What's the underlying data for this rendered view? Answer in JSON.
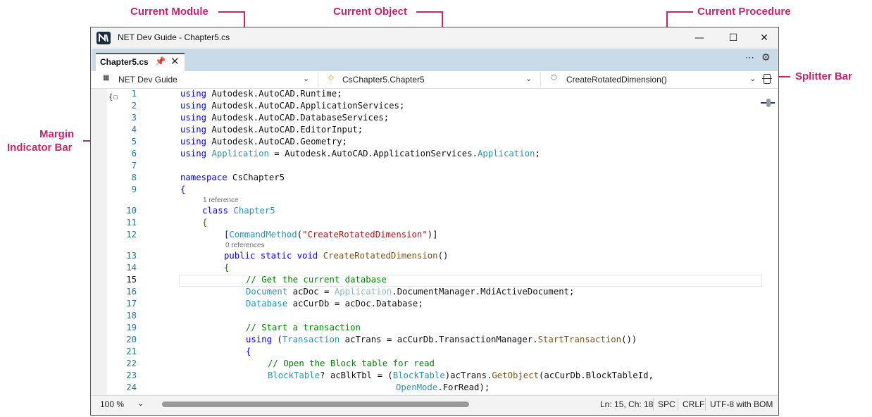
{
  "callouts": {
    "current_module": "Current Module",
    "current_object": "Current Object",
    "current_procedure": "Current Procedure",
    "splitter_bar": "Splitter Bar",
    "margin_indicator_bar_1": "Margin",
    "margin_indicator_bar_2": "Indicator Bar"
  },
  "window": {
    "title": "NET Dev Guide - Chapter5.cs",
    "icon": "dotnet-logo-icon"
  },
  "tab": {
    "label": "Chapter5.cs"
  },
  "nav": {
    "module": "NET Dev Guide",
    "object": "CsChapter5.Chapter5",
    "procedure": "CreateRotatedDimension()"
  },
  "code": {
    "ln": [
      "1",
      "2",
      "3",
      "4",
      "5",
      "6",
      "7",
      "8",
      "9",
      "10",
      "11",
      "12",
      "13",
      "14",
      "15",
      "16",
      "17",
      "18",
      "19",
      "20",
      "21",
      "22",
      "23",
      "24"
    ],
    "l1": [
      "using",
      " Autodesk.AutoCAD.Runtime;"
    ],
    "l2": [
      "using",
      " Autodesk.AutoCAD.ApplicationServices;"
    ],
    "l3": [
      "using",
      " Autodesk.AutoCAD.DatabaseServices;"
    ],
    "l4": [
      "using",
      " Autodesk.AutoCAD.EditorInput;"
    ],
    "l5": [
      "using",
      " Autodesk.AutoCAD.Geometry;"
    ],
    "l6": [
      "using",
      " ",
      "Application",
      " = Autodesk.AutoCAD.ApplicationServices.",
      "Application",
      ";"
    ],
    "l8": [
      "namespace",
      " CsChapter5"
    ],
    "l9": [
      "{"
    ],
    "lens1": "1 reference",
    "l10": [
      "class",
      " ",
      "Chapter5"
    ],
    "l11": [
      "{"
    ],
    "l12": [
      "[",
      "CommandMethod",
      "(",
      "\"CreateRotatedDimension\"",
      ")]"
    ],
    "lens2": "0 references",
    "l13": [
      "public",
      " ",
      "static",
      " ",
      "void",
      " ",
      "CreateRotatedDimension",
      "()"
    ],
    "l14": [
      "{"
    ],
    "l15": [
      "// Get the current database"
    ],
    "l16": [
      "Document",
      " acDoc = ",
      "Application",
      ".DocumentManager.MdiActiveDocument;"
    ],
    "l17": [
      "Database",
      " acCurDb = acDoc.Database;"
    ],
    "l19": [
      "// Start a transaction"
    ],
    "l20": [
      "using",
      " (",
      "Transaction",
      " acTrans = acCurDb.TransactionManager.",
      "StartTransaction",
      "())"
    ],
    "l21": [
      "{"
    ],
    "l22": [
      "// Open the Block table for read"
    ],
    "l23": [
      "BlockTable",
      "? acBlkTbl = (",
      "BlockTable",
      ")acTrans.",
      "GetObject",
      "(acCurDb.BlockTableId,"
    ],
    "l24": [
      "OpenMode",
      ".ForRead);"
    ]
  },
  "status": {
    "zoom": "100 %",
    "position": "Ln: 15, Ch: 18",
    "whitespace": "SPC",
    "line_ending": "CRLF",
    "encoding": "UTF-8 with BOM"
  }
}
